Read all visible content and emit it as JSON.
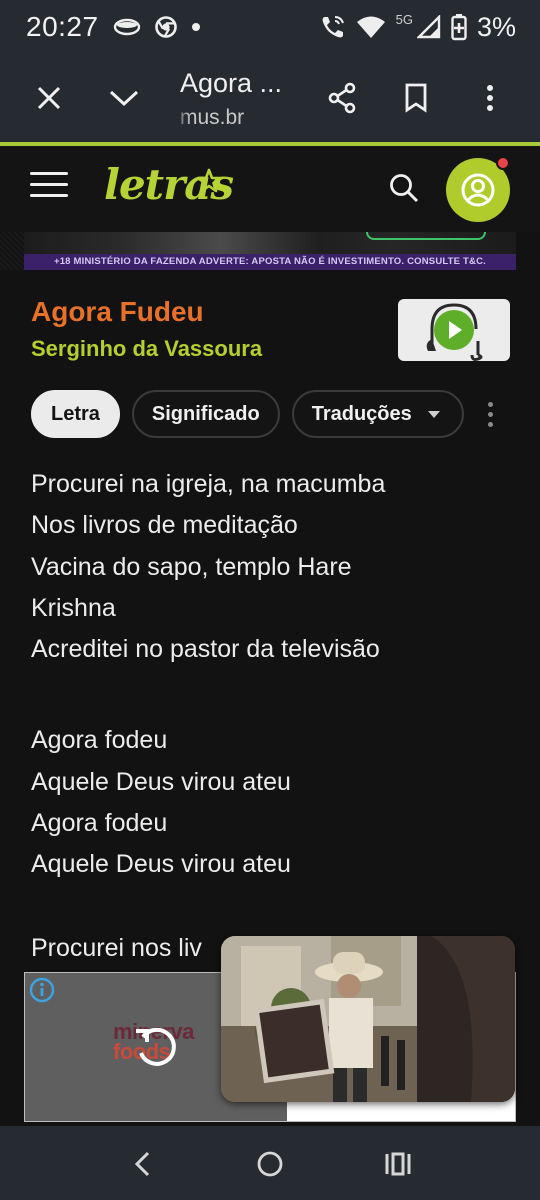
{
  "status_bar": {
    "time": "20:27",
    "network": "5G",
    "battery": "3%"
  },
  "browser": {
    "title": "Agora ...",
    "url": "mus.br"
  },
  "site": {
    "logo": "letras"
  },
  "ad_banner": {
    "text": "+18 MINISTÉRIO DA FAZENDA ADVERTE: APOSTA NÃO É INVESTIMENTO. CONSULTE T&C."
  },
  "song": {
    "title": "Agora Fudeu",
    "artist": "Serginho da Vassoura"
  },
  "tabs": [
    {
      "label": "Letra",
      "active": true
    },
    {
      "label": "Significado",
      "active": false
    },
    {
      "label": "Traduções",
      "active": false
    }
  ],
  "lyrics": {
    "verse1": [
      "Procurei na igreja, na macumba",
      "Nos livros de meditação",
      "Vacina do sapo, templo Hare",
      "Krishna",
      "Acreditei no pastor da televisão"
    ],
    "chorus": [
      "Agora fodeu",
      "Aquele Deus virou ateu",
      "Agora fodeu",
      "Aquele Deus virou ateu"
    ],
    "partial_line": "Procurei nos liv"
  },
  "bottom_ad": {
    "brand_line1": "minerva",
    "brand_line2": "foods"
  },
  "colors": {
    "accent_green": "#b5d334",
    "title_orange": "#e8712a",
    "background": "#121212"
  },
  "icons": {
    "close": "close-icon",
    "collapse": "chevron-down-icon",
    "share": "share-icon",
    "bookmark": "bookmark-icon",
    "overflow": "more-vert-icon",
    "menu": "hamburger-icon",
    "search": "search-icon",
    "account": "account-icon",
    "play": "play-icon",
    "info": "info-icon",
    "replay": "replay-icon",
    "back": "back-icon",
    "home": "home-icon",
    "recents": "recents-icon"
  }
}
